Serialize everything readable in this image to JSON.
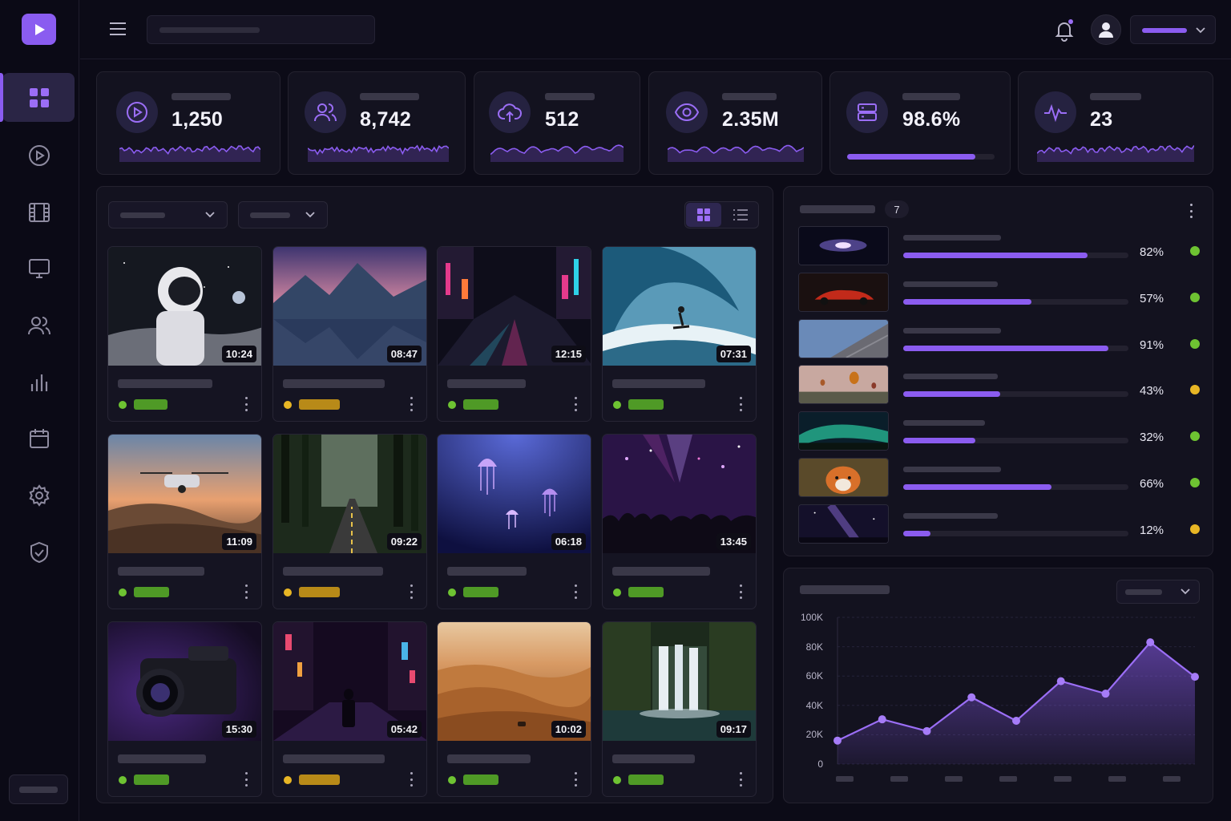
{
  "stats": [
    {
      "icon": "play-circle-icon",
      "value": "1,250"
    },
    {
      "icon": "users-icon",
      "value": "8,742"
    },
    {
      "icon": "cloud-upload-icon",
      "value": "512"
    },
    {
      "icon": "eye-icon",
      "value": "2.35M"
    },
    {
      "icon": "server-icon",
      "value": "98.6%",
      "progress": 0.87
    },
    {
      "icon": "activity-icon",
      "value": "23"
    }
  ],
  "videos": [
    {
      "duration": "10:24",
      "status": "green",
      "scene": "astronaut on moon"
    },
    {
      "duration": "08:47",
      "status": "yellow",
      "scene": "mountain lake at dusk"
    },
    {
      "duration": "12:15",
      "status": "green",
      "scene": "neon city street at night"
    },
    {
      "duration": "07:31",
      "status": "green",
      "scene": "surfer in wave"
    },
    {
      "duration": "11:09",
      "status": "green",
      "scene": "drone over hills"
    },
    {
      "duration": "09:22",
      "status": "yellow",
      "scene": "forest road"
    },
    {
      "duration": "06:18",
      "status": "green",
      "scene": "jellyfish underwater"
    },
    {
      "duration": "13:45",
      "status": "green",
      "scene": "concert crowd"
    },
    {
      "duration": "15:30",
      "status": "green",
      "scene": "film camera"
    },
    {
      "duration": "05:42",
      "status": "yellow",
      "scene": "neon alley walker"
    },
    {
      "duration": "10:02",
      "status": "green",
      "scene": "desert dunes"
    },
    {
      "duration": "09:17",
      "status": "green",
      "scene": "waterfall"
    }
  ],
  "top_videos": {
    "count": "7",
    "items": [
      {
        "percent": "82%",
        "value": 0.82,
        "status": "green",
        "scene": "galaxy"
      },
      {
        "percent": "57%",
        "value": 0.57,
        "status": "green",
        "scene": "red sports car"
      },
      {
        "percent": "91%",
        "value": 0.91,
        "status": "green",
        "scene": "building facade"
      },
      {
        "percent": "43%",
        "value": 0.43,
        "status": "yellow",
        "scene": "hot air balloons"
      },
      {
        "percent": "32%",
        "value": 0.32,
        "status": "green",
        "scene": "aurora"
      },
      {
        "percent": "66%",
        "value": 0.66,
        "status": "green",
        "scene": "fox"
      },
      {
        "percent": "12%",
        "value": 0.12,
        "status": "yellow",
        "scene": "milky way"
      }
    ]
  },
  "chart_data": {
    "type": "area",
    "y_ticks": [
      "100K",
      "80K",
      "60K",
      "40K",
      "20K",
      "0"
    ],
    "ylim": [
      0,
      100000
    ],
    "values": [
      16000,
      30500,
      22500,
      45500,
      29500,
      56500,
      48000,
      83000,
      59500
    ],
    "grid": true
  },
  "colors": {
    "accent": "#8b5cf0",
    "status_green": "#6ec332",
    "status_yellow": "#e8b625",
    "background": "#0c0b17",
    "card": "#13121f"
  }
}
